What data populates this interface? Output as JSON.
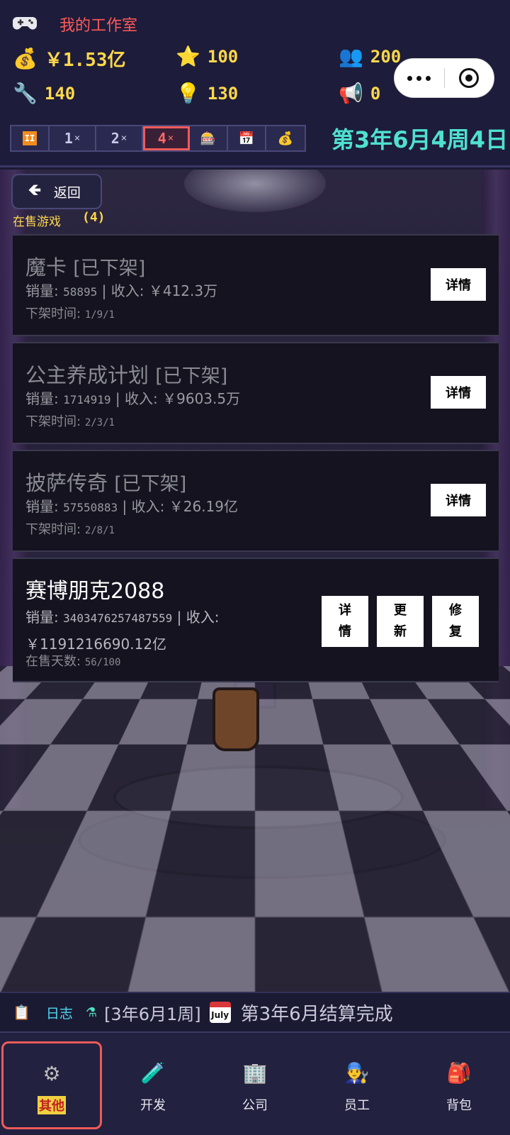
{
  "header": {
    "title": "我的工作室",
    "money_icon": "💰",
    "money": "￥1.53亿",
    "star_icon": "⭐",
    "fame": "100",
    "staff_icon": "👥",
    "fans": "200",
    "wrench_icon": "🔧",
    "tech": "140",
    "bulb_icon": "💡",
    "idea": "130",
    "horn_icon": "📢",
    "ad": "0",
    "date": "第3年6月4周4日"
  },
  "speed": {
    "pause": "II",
    "x1": "1",
    "x2": "2",
    "x4": "4",
    "times": "×",
    "slot_icon": "🎰",
    "calendar_icon": "📅",
    "moneybag_icon": "💰",
    "active": "4"
  },
  "nav_back": {
    "label": "返回"
  },
  "list": {
    "title": "在售游戏",
    "count": "(4)",
    "detail_label": "详情",
    "items": [
      {
        "name": "魔卡",
        "status": "[已下架]",
        "sales_label": "销量:",
        "sales": "58895",
        "sep": "|",
        "income_label": "收入:",
        "income": "￥412.3万",
        "time_label": "下架时间:",
        "time": "1/9/1"
      },
      {
        "name": "公主养成计划",
        "status": "[已下架]",
        "sales_label": "销量:",
        "sales": "1714919",
        "sep": "|",
        "income_label": "收入:",
        "income": "￥9603.5万",
        "time_label": "下架时间:",
        "time": "2/3/1"
      },
      {
        "name": "披萨传奇",
        "status": "[已下架]",
        "sales_label": "销量:",
        "sales": "57550883",
        "sep": "|",
        "income_label": "收入:",
        "income": "￥26.19亿",
        "time_label": "下架时间:",
        "time": "2/8/1"
      },
      {
        "name": "赛博朋克2088",
        "sales_label": "销量:",
        "sales": "3403476257487559",
        "sep": "|",
        "income_label": "收入:",
        "income": "￥1191216690.12亿",
        "days_label": "在售天数:",
        "days": "56/100",
        "btn_detail": "详情",
        "btn_update": "更新",
        "btn_fix": "修复"
      }
    ]
  },
  "log": {
    "clip_icon": "📋",
    "label": "日志",
    "flask_icon": "⚗",
    "week": "[3年6月1周]",
    "calendar_text": "July",
    "message": "第3年6月结算完成"
  },
  "nav": {
    "items": [
      {
        "icon": "⚙",
        "label": "其他"
      },
      {
        "icon": "🧪",
        "label": "开发"
      },
      {
        "icon": "🏢",
        "label": "公司"
      },
      {
        "icon": "👨‍🔧",
        "label": "员工"
      },
      {
        "icon": "🎒",
        "label": "背包"
      }
    ]
  }
}
